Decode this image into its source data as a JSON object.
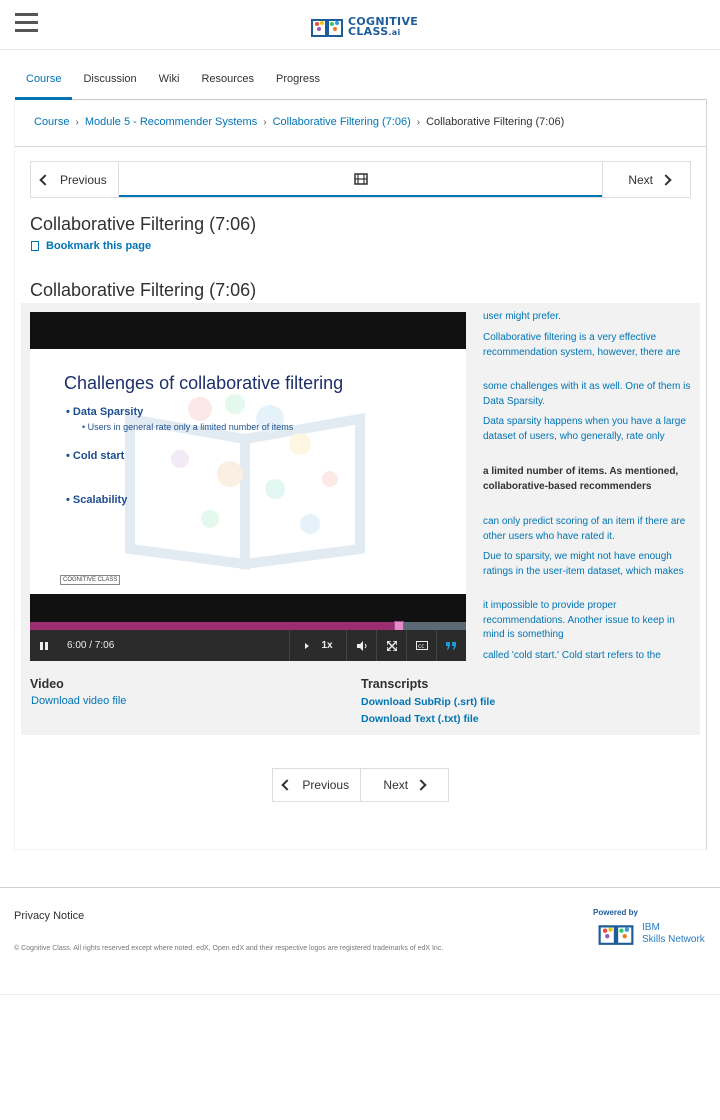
{
  "header": {
    "logo_line1": "COGNITIVE",
    "logo_line2": "CLASS",
    "logo_suffix": ".ai"
  },
  "tabs": [
    {
      "label": "Course",
      "active": true
    },
    {
      "label": "Discussion"
    },
    {
      "label": "Wiki"
    },
    {
      "label": "Resources"
    },
    {
      "label": "Progress"
    }
  ],
  "breadcrumb": {
    "items": [
      "Course",
      "Module 5 - Recommender Systems",
      "Collaborative Filtering (7:06)"
    ],
    "current": "Collaborative Filtering (7:06)"
  },
  "sequence_nav": {
    "previous_label": "Previous",
    "next_label": "Next",
    "unit_icon": "film-icon"
  },
  "unit": {
    "title": "Collaborative Filtering (7:06)",
    "bookmark_label": "Bookmark this page",
    "video_title": "Collaborative Filtering (7:06)"
  },
  "slide": {
    "title": "Challenges of collaborative filtering",
    "bullets": [
      "Data Sparsity",
      "Cold start",
      "Scalability"
    ],
    "sub_bullet": "Users in general rate only a limited number of items",
    "logo_text": "COGNITIVE CLASS"
  },
  "player": {
    "time": "6:00 / 7:06",
    "speed": "1x",
    "progress_fraction": 0.845,
    "accent": "#9b2e70"
  },
  "transcript": [
    "user might prefer.",
    "Collaborative filtering is a very effective recommendation system, however, there are",
    "some challenges with it as well. One of them is Data Sparsity.",
    "Data sparsity happens when you have a large dataset of users, who generally, rate only",
    "a limited number of items. As mentioned, collaborative-based recommenders",
    "can only predict scoring of an item if there are other users who have rated it.",
    "Due to sparsity, we might not have enough ratings in the user-item dataset, which makes",
    "it impossible to provide proper recommendations. Another issue to keep in mind is something",
    "called 'cold start.' Cold start refers to the"
  ],
  "transcript_current_index": 4,
  "downloads": {
    "video_heading": "Video",
    "video_link": "Download video file",
    "transcripts_heading": "Transcripts",
    "srt_link": "Download SubRip (.srt) file",
    "txt_link": "Download Text (.txt) file"
  },
  "pager": {
    "previous_label": "Previous",
    "next_label": "Next"
  },
  "footer": {
    "privacy": "Privacy Notice",
    "copyright": "© Cognitive Class. All rights reserved except where noted. edX, Open edX and their respective logos are registered trademarks of edX Inc.",
    "powered_by": "Powered by",
    "ibm_line1": "IBM",
    "ibm_line2": "Skills Network"
  },
  "colors": {
    "link": "#0075b4",
    "text": "#313131"
  }
}
